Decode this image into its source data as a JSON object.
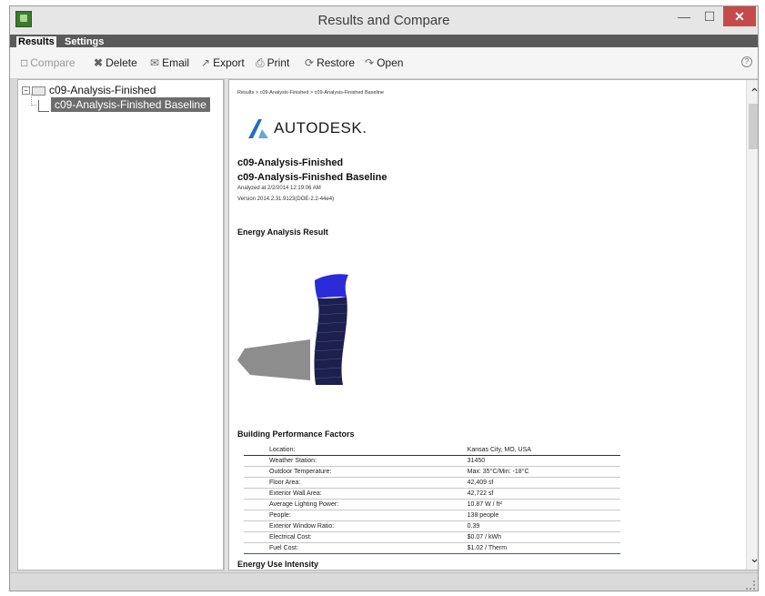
{
  "window": {
    "title": "Results and Compare"
  },
  "tabs": {
    "results": "Results",
    "settings": "Settings"
  },
  "toolbar": {
    "compare": "Compare",
    "delete": "Delete",
    "email": "Email",
    "export": "Export",
    "print": "Print",
    "restore": "Restore",
    "open": "Open",
    "help": "?"
  },
  "tree": {
    "root": "c09-Analysis-Finished",
    "child": "c09-Analysis-Finished Baseline"
  },
  "report": {
    "breadcrumb": "Results > c09-Analysis-Finished > c09-Analysis-Finished Baseline",
    "logo_text": "AUTODESK.",
    "title1": "c09-Analysis-Finished",
    "title2": "c09-Analysis-Finished Baseline",
    "analyzed": "Analyzed at 2/2/2014 12:19:06 AM",
    "version": "Version 2014.2.31.9123(DOE-2.2-44e4)",
    "energy_heading": "Energy Analysis Result",
    "bpf_heading": "Building Performance Factors",
    "bpf_rows": [
      {
        "label": "Location:",
        "value": "Kansas City, MO, USA"
      },
      {
        "label": "Weather Station:",
        "value": "31450"
      },
      {
        "label": "Outdoor Temperature:",
        "value": "Max: 35°C/Min: -18°C"
      },
      {
        "label": "Floor Area:",
        "value": "42,409 sf"
      },
      {
        "label": "Exterior Wall Area:",
        "value": "42,722 sf"
      },
      {
        "label": "Average Lighting Power:",
        "value": "10.87 W / ft²"
      },
      {
        "label": "People:",
        "value": "138 people"
      },
      {
        "label": "Exterior Window Ratio:",
        "value": "0.39"
      },
      {
        "label": "Electrical Cost:",
        "value": "$0.07 / kWh"
      },
      {
        "label": "Fuel Cost:",
        "value": "$1.02 / Therm"
      }
    ],
    "eui_heading": "Energy Use Intensity"
  },
  "colors": {
    "logo_blue": "#1f6fbf",
    "logo_light": "#5fa9e6",
    "selection": "#6d6d6d",
    "close": "#c74a4a"
  }
}
